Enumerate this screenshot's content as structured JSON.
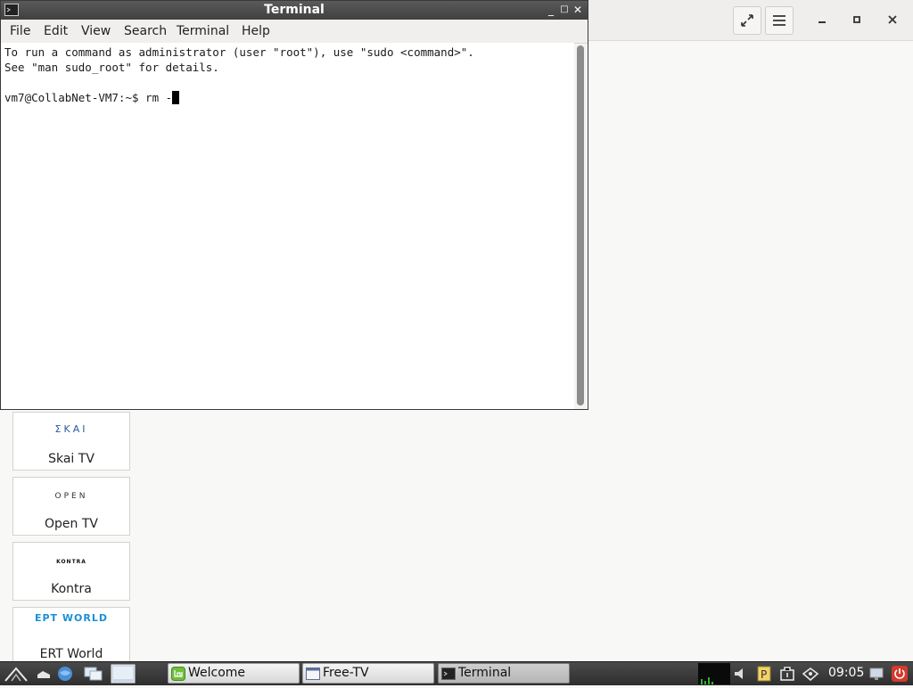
{
  "terminal": {
    "title": "Terminal",
    "menu": [
      "File",
      "Edit",
      "View",
      "Search",
      "Terminal",
      "Help"
    ],
    "lines": [
      "To run a command as administrator (user \"root\"), use \"sudo <command>\".",
      "See \"man sudo_root\" for details.",
      "",
      "vm7@CollabNet-VM7:~$ rm -"
    ],
    "controls": {
      "minimize": "_",
      "maximize": "□",
      "close": "✕"
    }
  },
  "background_app": {
    "header_icons": [
      "fullscreen-icon",
      "hamburger-menu-icon",
      "minimize-icon",
      "maximize-icon",
      "close-icon"
    ],
    "channels": [
      {
        "logo": "ΣΚΑΙ",
        "name": "Skai TV"
      },
      {
        "logo": "OPEN",
        "name": "Open TV"
      },
      {
        "logo": "KONTRA",
        "name": "Kontra"
      },
      {
        "logo": "EPT WORLD",
        "name": "ERT World"
      }
    ]
  },
  "taskbar": {
    "tasks": [
      {
        "label": "Welcome",
        "active": false
      },
      {
        "label": "Free-TV",
        "active": false
      },
      {
        "label": "Terminal",
        "active": true
      }
    ],
    "clock": "09:05"
  }
}
